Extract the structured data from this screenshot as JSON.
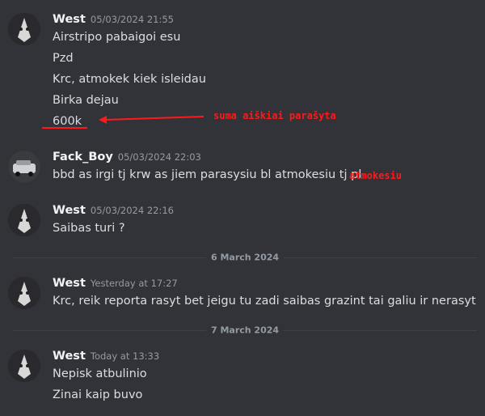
{
  "messages": [
    {
      "author": "West",
      "timestamp": "05/03/2024 21:55",
      "avatar": "skull-mask-avatar",
      "lines": [
        "Airstripo pabaigoi esu",
        "Pzd",
        "Krc, atmokek kiek isleidau",
        "Birka dejau",
        "600k"
      ]
    },
    {
      "author": "Fack_Boy",
      "timestamp": "05/03/2024 22:03",
      "avatar": "car-avatar",
      "lines": [
        "bbd as irgi tj krw as jiem parasysiu bl   atmokesiu tj pl"
      ]
    },
    {
      "author": "West",
      "timestamp": "05/03/2024 22:16",
      "avatar": "skull-mask-avatar",
      "lines": [
        "Saibas turi ?"
      ]
    },
    {
      "author": "West",
      "timestamp": "Yesterday at 17:27",
      "avatar": "skull-mask-avatar",
      "lines": [
        "Krc, reik reporta rasyt bet jeigu tu zadi saibas grazint tai galiu ir nerasyt"
      ]
    },
    {
      "author": "West",
      "timestamp": "Today at 13:33",
      "avatar": "skull-mask-avatar",
      "lines": [
        "Nepisk atbulinio",
        "Zinai kaip buvo"
      ]
    }
  ],
  "dividers": [
    "6 March 2024",
    "7 March 2024"
  ],
  "annotations": {
    "amount_note": "suma aiškiai parašyta",
    "repay_note": "atmokesiu",
    "color": "#ff1a1a"
  }
}
